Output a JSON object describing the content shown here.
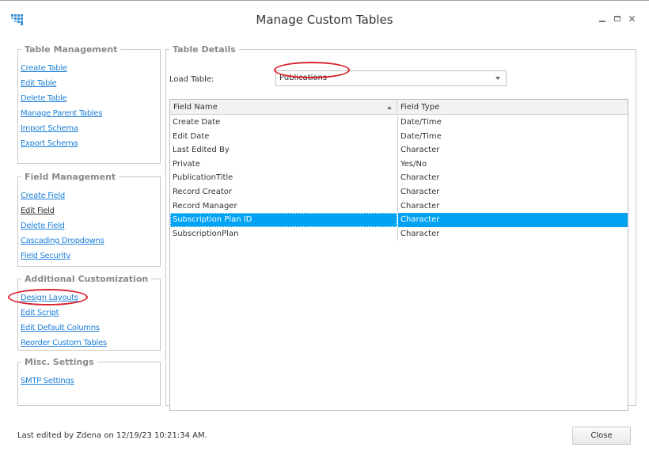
{
  "window": {
    "title": "Manage Custom Tables",
    "app_icon": "grid-staircase-icon",
    "controls": {
      "minimize": "minimize-icon",
      "maximize": "maximize-icon",
      "close": "close-icon",
      "close_glyph": "✕"
    }
  },
  "groups": {
    "table_management": {
      "title": "Table Management",
      "links": [
        {
          "label": "Create Table"
        },
        {
          "label": "Edit Table"
        },
        {
          "label": "Delete Table"
        },
        {
          "label": "Manage Parent Tables"
        },
        {
          "label": "Import Schema"
        },
        {
          "label": "Export Schema"
        }
      ]
    },
    "field_management": {
      "title": "Field Management",
      "links": [
        {
          "label": "Create Field"
        },
        {
          "label": "Edit Field",
          "visited": true
        },
        {
          "label": "Delete Field"
        },
        {
          "label": "Cascading Dropdowns"
        },
        {
          "label": "Field Security"
        }
      ]
    },
    "additional_customization": {
      "title": "Additional Customization",
      "links": [
        {
          "label": "Design Layouts",
          "annotated": true
        },
        {
          "label": "Edit Script"
        },
        {
          "label": "Edit Default Columns"
        },
        {
          "label": "Reorder Custom Tables"
        }
      ]
    },
    "misc_settings": {
      "title": "Misc. Settings",
      "links": [
        {
          "label": "SMTP Settings"
        }
      ]
    }
  },
  "table_details": {
    "title": "Table Details",
    "load_table_label": "Load Table:",
    "load_table_value": "Publications",
    "grid": {
      "columns": [
        "Field Name",
        "Field Type"
      ],
      "sort": {
        "column": "Field Name",
        "direction": "ascending"
      },
      "rows": [
        {
          "name": "Create Date",
          "type": "Date/Time"
        },
        {
          "name": "Edit Date",
          "type": "Date/Time"
        },
        {
          "name": "Last Edited By",
          "type": "Character"
        },
        {
          "name": "Private",
          "type": "Yes/No"
        },
        {
          "name": "PublicationTitle",
          "type": "Character"
        },
        {
          "name": "Record Creator",
          "type": "Character"
        },
        {
          "name": "Record Manager",
          "type": "Character"
        },
        {
          "name": "Subscription Plan ID",
          "type": "Character",
          "selected": true
        },
        {
          "name": "SubscriptionPlan",
          "type": "Character"
        }
      ]
    }
  },
  "footer": {
    "status": "Last edited by Zdena on 12/19/23 10:21:34 AM.",
    "close_label": "Close"
  },
  "colors": {
    "link": "#1c7fd8",
    "selection": "#00a2f3",
    "annotation": "#d81f2a",
    "legend_text": "#8a8a8a"
  }
}
